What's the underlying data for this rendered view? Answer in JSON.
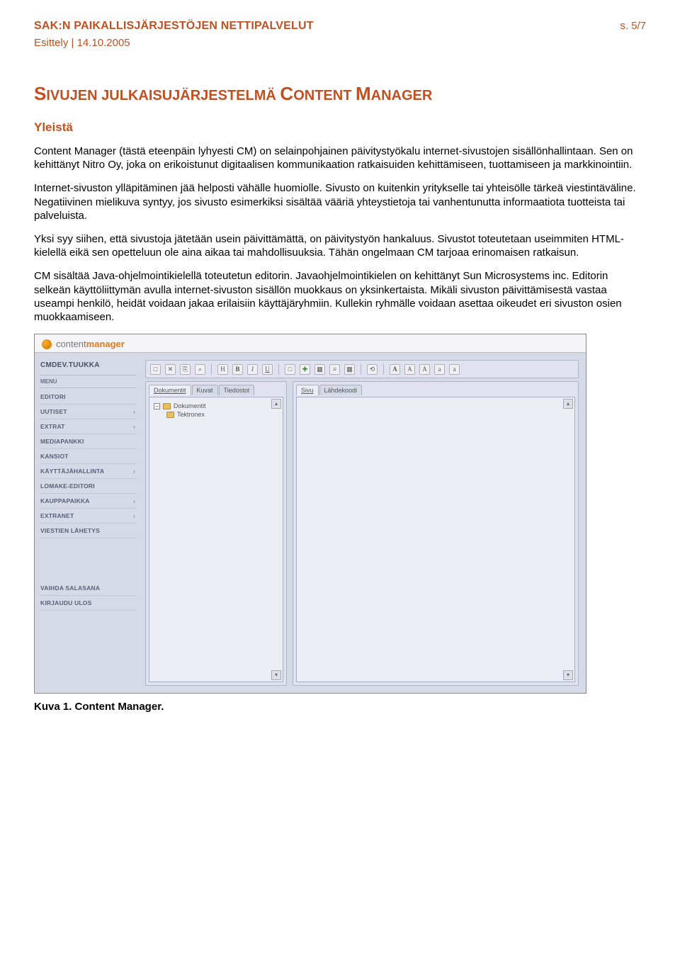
{
  "header": {
    "title": "SAK:N PAIKALLISJÄRJESTÖJEN NETTIPALVELUT",
    "page": "s. 5/7",
    "subtitle": "Esittely | 14.10.2005"
  },
  "main_heading_pre": "S",
  "main_heading_mid1": "IVUJEN JULKAISUJÄRJESTELMÄ ",
  "main_heading_cap2": "C",
  "main_heading_mid2": "ONTENT ",
  "main_heading_cap3": "M",
  "main_heading_mid3": "ANAGER",
  "section_heading": "Yleistä",
  "paragraphs": [
    "Content Manager (tästä eteenpäin lyhyesti CM) on selainpohjainen päivitystyökalu internet-sivustojen sisällönhallintaan. Sen on kehittänyt Nitro Oy, joka on erikoistunut digitaalisen kommunikaation ratkaisuiden kehittämiseen, tuottamiseen ja markkinointiin.",
    "Internet-sivuston ylläpitäminen jää helposti vähälle huomiolle. Sivusto on kuitenkin yritykselle tai yhteisölle tärkeä viestintäväline. Negatiivinen mielikuva syntyy, jos sivusto esimerkiksi sisältää vääriä yhteystietoja tai vanhentunutta informaatiota tuotteista tai palveluista.",
    "Yksi syy siihen, että sivustoja jätetään usein päivittämättä, on päivitystyön hankaluus. Sivustot toteutetaan useimmiten HTML-kielellä eikä sen opetteluun ole aina aikaa tai mahdollisuuksia. Tähän ongelmaan CM tarjoaa erinomaisen ratkaisun.",
    "CM sisältää Java-ohjelmointikielellä toteutetun editorin. Javaohjelmointikielen on kehittänyt Sun Microsystems inc. Editorin selkeän käyttöliittymän avulla internet-sivuston sisällön muokkaus on yksinkertaista. Mikäli sivuston päivittämisestä vastaa useampi henkilö, heidät voidaan jakaa erilaisiin käyttäjäryhmiin. Kullekin ryhmälle voidaan asettaa oikeudet eri sivuston osien muokkaamiseen."
  ],
  "cm_app": {
    "logo_text1": "content",
    "logo_text2": "manager",
    "user": "CMDEV.TUUKKA",
    "menu_label": "MENU",
    "menu_items": [
      "EDITORI",
      "UUTISET",
      "EXTRAT",
      "MEDIAPANKKI",
      "KANSIOT",
      "KÄYTTÄJÄHALLINTA",
      "LOMAKE-EDITORI",
      "KAUPPAPAIKKA",
      "EXTRANET",
      "VIESTIEN LÄHETYS"
    ],
    "footer_items": [
      "VAIHDA SALASANA",
      "KIRJAUDU ULOS"
    ],
    "toolbar_icons": [
      "□",
      "✕",
      "⎘",
      "⌕",
      "H",
      "B",
      "I",
      "U",
      "□",
      "✚",
      "▦",
      "≡",
      "▦",
      "⟲",
      "A",
      "A",
      "A",
      "a",
      "a"
    ],
    "left_tabs": [
      "Dokumentit",
      "Kuvat",
      "Tiedostot"
    ],
    "right_tabs": [
      "Sivu",
      "Lähdekoodi"
    ],
    "tree_root": "Dokumentit",
    "tree_child": "Tektronex"
  },
  "caption": "Kuva 1. Content Manager."
}
